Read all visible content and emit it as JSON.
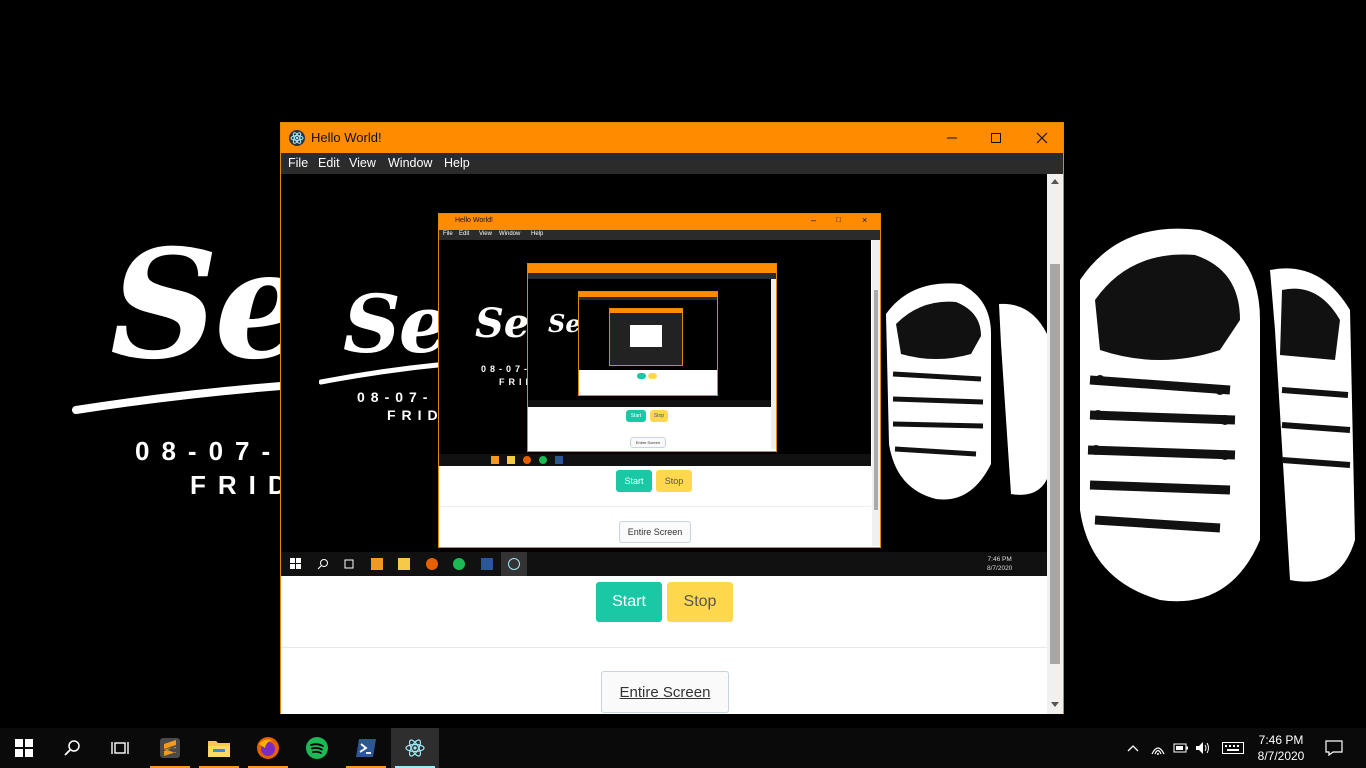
{
  "window": {
    "title": "Hello World!",
    "menu": [
      "File",
      "Edit",
      "View",
      "Window",
      "Help"
    ]
  },
  "wallpaper": {
    "text": "Se",
    "date": "08-07-",
    "day": "FRID"
  },
  "buttons": {
    "start": "Start",
    "stop": "Stop",
    "entire_screen": "Entire Screen"
  },
  "taskbar": {
    "apps": [
      "sublime-text-icon",
      "file-explorer-icon",
      "firefox-icon",
      "spotify-icon",
      "powershell-icon",
      "electron-icon"
    ],
    "time": "7:46 PM",
    "date": "8/7/2020"
  },
  "colors": {
    "titlebar": "#ff8c00",
    "start": "#1ac8a6",
    "stop": "#ffd84d"
  }
}
